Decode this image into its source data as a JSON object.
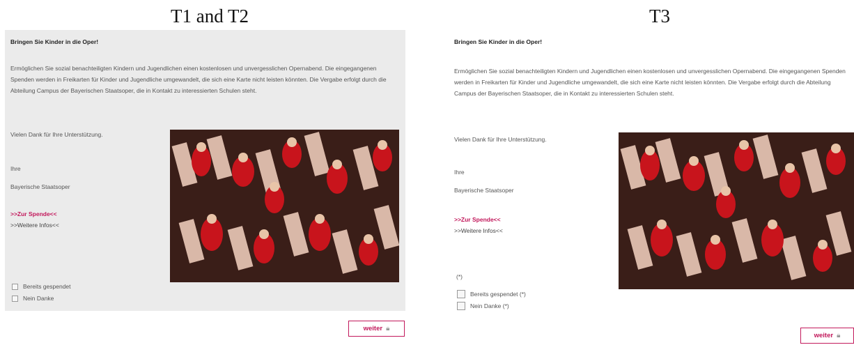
{
  "left": {
    "title": "T1 and T2",
    "heading": "Bringen Sie Kinder in die Oper!",
    "paragraph": "Ermöglichen Sie sozial benachteiligten Kindern und Jugendlichen einen kostenlosen und unvergesslichen Opernabend. Die eingegangenen Spenden werden in Freikarten für Kinder und Jugendliche umgewandelt, die sich eine Karte nicht leisten könnten. Die Vergabe erfolgt durch die Abteilung Campus der Bayerischen Staatsoper, die in Kontakt zu interessierten Schulen steht.",
    "thanks": "Vielen Dank für Ihre Unterstützung.",
    "ihre": "Ihre",
    "org": "Bayerische Staatsoper",
    "link_donate": ">>Zur Spende<<",
    "link_info": ">>Weitere Infos<<",
    "checkbox_1": "Bereits gespendet",
    "checkbox_2": "Nein Danke",
    "button": "weiter"
  },
  "right": {
    "title": "T3",
    "heading": "Bringen Sie Kinder in die Oper!",
    "paragraph": "Ermöglichen Sie sozial benachteiligten Kindern und Jugendlichen einen kostenlosen und unvergesslichen Opernabend. Die eingegangenen Spenden werden in Freikarten für Kinder und Jugendliche umgewandelt, die sich eine Karte nicht leisten könnten. Die Vergabe erfolgt durch die Abteilung Campus der Bayerischen Staatsoper, die in Kontakt zu interessierten Schulen steht.",
    "thanks": "Vielen Dank für Ihre Unterstützung.",
    "ihre": "Ihre",
    "org": "Bayerische Staatsoper",
    "link_donate": ">>Zur Spende<<",
    "link_info": ">>Weitere Infos<<",
    "note": "(*)",
    "checkbox_1": "Bereits gespendet (*)",
    "checkbox_2": "Nein Danke (*)",
    "button": "weiter"
  },
  "colors": {
    "accent": "#c2185b",
    "panel": "#ebebeb"
  },
  "icons": {
    "button_icon": "lock-check-icon"
  }
}
